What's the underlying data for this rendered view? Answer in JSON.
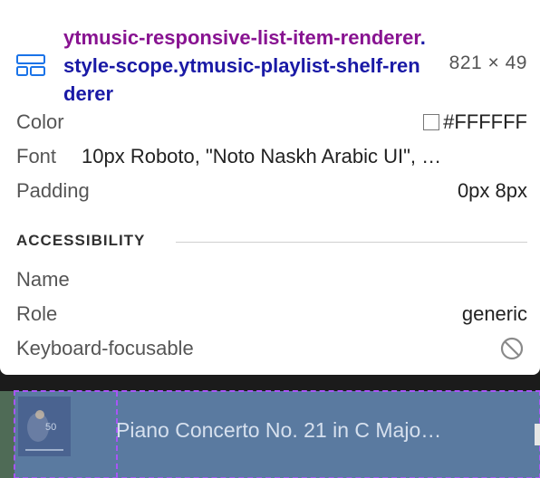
{
  "tooltip": {
    "selector_tag": "ytmusic-responsive-list-item-renderer",
    "selector_classes": ".style-scope.ytmusic-playlist-shelf-renderer",
    "dimensions": "821 × 49",
    "properties": [
      {
        "label": "Color",
        "value": "#FFFFFF"
      },
      {
        "label": "Font",
        "value": "10px Roboto, \"Noto Naskh Arabic UI\", …"
      },
      {
        "label": "Padding",
        "value": "0px 8px"
      }
    ],
    "accessibility": {
      "heading": "ACCESSIBILITY",
      "rows": [
        {
          "label": "Name",
          "value": ""
        },
        {
          "label": "Role",
          "value": "generic"
        },
        {
          "label": "Keyboard-focusable",
          "value": ""
        }
      ]
    }
  },
  "page": {
    "item_title": "Piano Concerto No. 21 in C Majo…",
    "thumb_label": "50"
  },
  "colors": {
    "tag": "#881391",
    "classes": "#1a1aa6",
    "highlight": "#a855f7",
    "item_bg": "#5a7aa0"
  }
}
